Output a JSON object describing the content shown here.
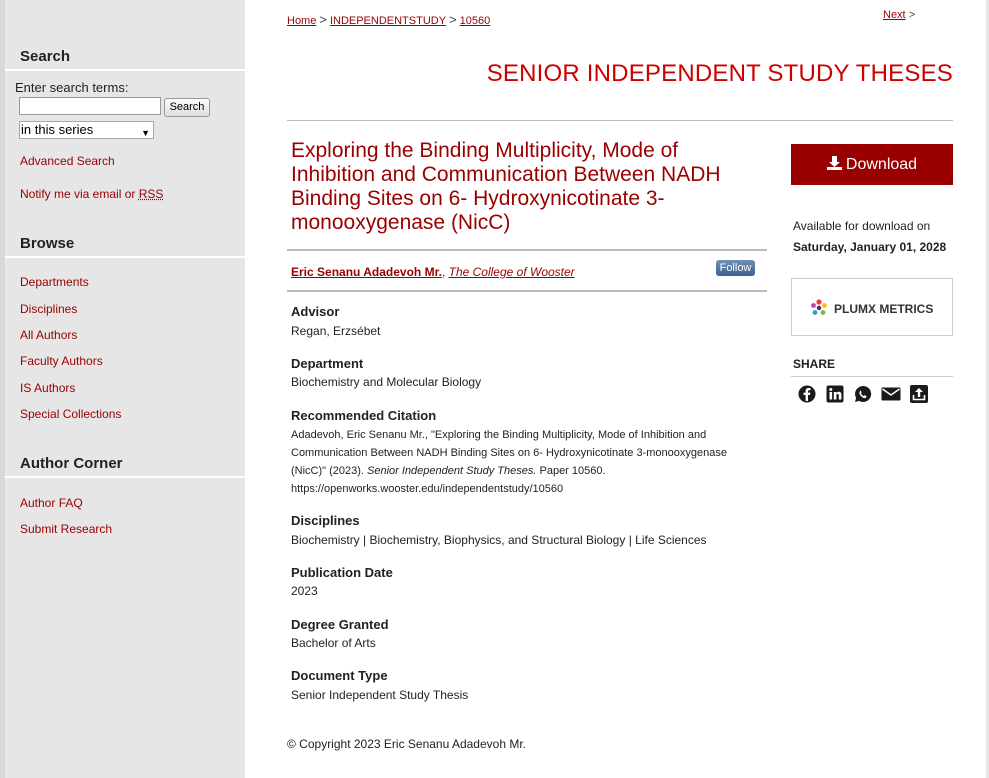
{
  "sidebar": {
    "search_heading": "Search",
    "search_label": "Enter search terms:",
    "search_placeholder": "",
    "search_button": "Search",
    "scope_selected": "in this series",
    "advanced_search": "Advanced Search",
    "notify_text": "Notify me via email or ",
    "rss_label": "RSS",
    "browse_heading": "Browse",
    "browse_items": [
      "Departments",
      "Disciplines",
      "All Authors",
      "Faculty Authors",
      "IS Authors",
      "Special Collections"
    ],
    "author_heading": "Author Corner",
    "author_items": [
      "Author FAQ",
      "Submit Research"
    ]
  },
  "breadcrumb": {
    "home": "Home",
    "series": "INDEPENDENTSTUDY",
    "item": "10560",
    "sep": ">"
  },
  "next_nav": {
    "label": "Next",
    "sep": ">"
  },
  "series_title": "SENIOR INDEPENDENT STUDY THESES",
  "paper": {
    "title": "Exploring the Binding Multiplicity, Mode of Inhibition and Communication Between NADH Binding Sites on 6- Hydroxynicotinate 3-monooxygenase (NicC)",
    "author_name": "Eric Senanu Adadevoh Mr.",
    "author_sep": ", ",
    "author_affiliation": "The College of Wooster",
    "follow": "Follow"
  },
  "fields": {
    "advisor_label": "Advisor",
    "advisor_value": "Regan, Erzsébet",
    "department_label": "Department",
    "department_value": "Biochemistry and Molecular Biology",
    "citation_label": "Recommended Citation",
    "citation_part1": "Adadevoh, Eric Senanu Mr., \"Exploring the Binding Multiplicity, Mode of Inhibition and Communication Between NADH Binding Sites on 6- Hydroxynicotinate 3-monooxygenase (NicC)\" (2023). ",
    "citation_journal": "Senior Independent Study Theses.",
    "citation_part2": " Paper 10560.",
    "citation_url": "https://openworks.wooster.edu/independentstudy/10560",
    "disciplines_label": "Disciplines",
    "disciplines_value": "Biochemistry | Biochemistry, Biophysics, and Structural Biology | Life Sciences",
    "pubdate_label": "Publication Date",
    "pubdate_value": "2023",
    "degree_label": "Degree Granted",
    "degree_value": "Bachelor of Arts",
    "doctype_label": "Document Type",
    "doctype_value": "Senior Independent Study Thesis"
  },
  "aside": {
    "download": "Download",
    "avail_label": "Available for download on",
    "avail_date": "Saturday, January 01, 2028",
    "plumx": "PLUMX METRICS",
    "share": "SHARE",
    "share_icons": [
      "facebook-icon",
      "linkedin-icon",
      "whatsapp-icon",
      "email-icon",
      "share-icon"
    ]
  },
  "footer": {
    "copyright": "© Copyright 2023 Eric Senanu Adadevoh Mr."
  },
  "colors": {
    "accent": "#990000",
    "series_title": "#cc0000",
    "sidebar_bg": "#e6e6e6",
    "follow_bg": "#4a6a96"
  }
}
